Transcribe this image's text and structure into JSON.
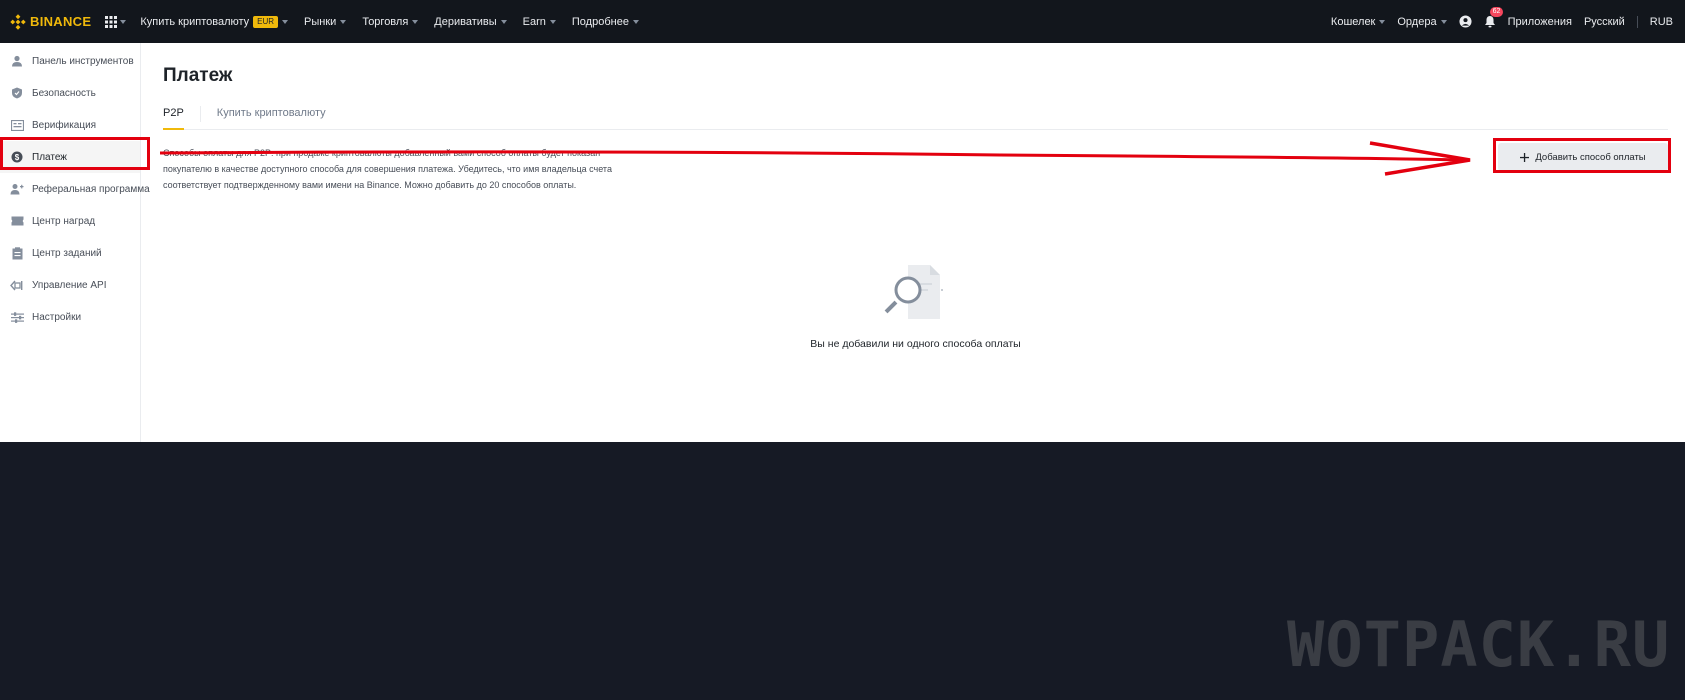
{
  "topnav": {
    "brand": "BINANCE",
    "items": [
      {
        "label": "Купить криптовалюту",
        "badge": "EUR"
      },
      {
        "label": "Рынки"
      },
      {
        "label": "Торговля"
      },
      {
        "label": "Деривативы"
      },
      {
        "label": "Earn"
      },
      {
        "label": "Подробнее"
      }
    ],
    "right": {
      "wallet": "Кошелек",
      "orders": "Ордера",
      "notifications_count": "62",
      "apps": "Приложения",
      "language": "Русский",
      "currency": "RUB"
    }
  },
  "sidebar": {
    "items": [
      {
        "label": "Панель инструментов",
        "icon": "user-icon"
      },
      {
        "label": "Безопасность",
        "icon": "shield-icon"
      },
      {
        "label": "Верификация",
        "icon": "id-card-icon"
      },
      {
        "label": "Платеж",
        "icon": "dollar-coin-icon",
        "active": true
      },
      {
        "label": "Реферальная программа",
        "icon": "add-user-icon"
      },
      {
        "label": "Центр наград",
        "icon": "ticket-icon"
      },
      {
        "label": "Центр заданий",
        "icon": "clipboard-icon"
      },
      {
        "label": "Управление API",
        "icon": "api-icon"
      },
      {
        "label": "Настройки",
        "icon": "sliders-icon"
      }
    ]
  },
  "main": {
    "title": "Платеж",
    "tabs": [
      {
        "label": "P2P",
        "active": true
      },
      {
        "label": "Купить криптовалюту"
      }
    ],
    "description": "Способы оплаты для P2P: при продаже криптовалюты добавленный вами способ оплаты будет показан покупателю в качестве доступного способа для совершения платежа. Убедитесь, что имя владельца счета соответствует подтвержденному вами имени на Binance. Можно добавить до 20 способов оплаты.",
    "add_button": "Добавить способ оплаты",
    "empty_text": "Вы не добавили ни одного способа оплаты"
  },
  "watermark": "WOTPACK.RU",
  "colors": {
    "brand": "#f0b90b",
    "highlight": "#e3000f",
    "topbar": "#12161c",
    "background": "#161a25"
  }
}
